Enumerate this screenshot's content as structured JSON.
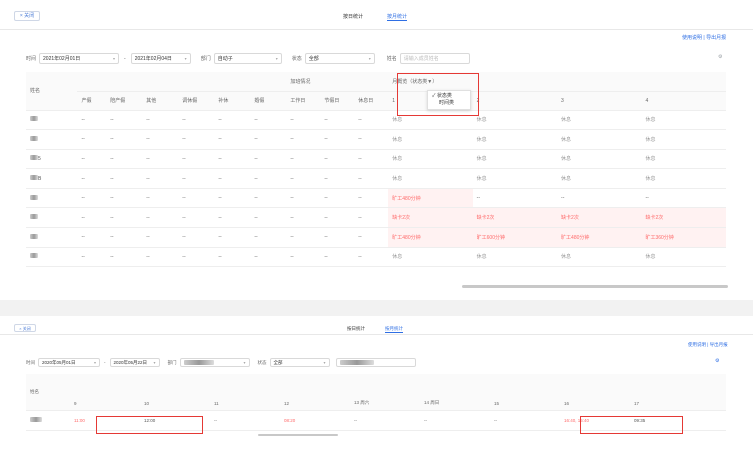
{
  "top": {
    "close_label": "× 关闭",
    "tabs": [
      "按日统计",
      "按月统计"
    ],
    "links": "使用说明 | 导出月报",
    "filters": {
      "time_label": "时间",
      "start_date": "2021年02月01日",
      "dash": "-",
      "end_date": "2021年02月04日",
      "dept_label": "部门",
      "dept_value": "自动子",
      "status_label": "状态",
      "status_value": "全部",
      "name_label": "姓名",
      "name_placeholder": "请输入成员姓名"
    },
    "table": {
      "col_name": "姓名",
      "col_overtime_group": "加班情况",
      "col_month_group": "月概览（状态类▼）",
      "leave_cols": [
        "产假",
        "陪产假",
        "其他",
        "调休假",
        "补休",
        "婚假"
      ],
      "overtime_cols": [
        "工作日",
        "节假日",
        "休息日"
      ],
      "day_cols": [
        "1",
        "2",
        "3",
        "4"
      ],
      "rows": [
        {
          "mark": "",
          "cells": [
            "--",
            "--",
            "--",
            "--",
            "--",
            "--",
            "--",
            "--",
            "--"
          ],
          "days": [
            "休息",
            "休息",
            "休息",
            "休息"
          ]
        },
        {
          "mark": "",
          "cells": [
            "--",
            "--",
            "--",
            "--",
            "--",
            "--",
            "--",
            "--",
            "--"
          ],
          "days": [
            "休息",
            "休息",
            "休息",
            "休息"
          ]
        },
        {
          "mark": "5",
          "cells": [
            "--",
            "--",
            "--",
            "--",
            "--",
            "--",
            "--",
            "--",
            "--"
          ],
          "days": [
            "休息",
            "休息",
            "休息",
            "休息"
          ]
        },
        {
          "mark": "B",
          "cells": [
            "--",
            "--",
            "--",
            "--",
            "--",
            "--",
            "--",
            "--",
            "--"
          ],
          "days": [
            "休息",
            "休息",
            "休息",
            "休息"
          ]
        },
        {
          "mark": "",
          "cells": [
            "--",
            "--",
            "--",
            "--",
            "--",
            "--",
            "--",
            "--",
            "--"
          ],
          "days": [
            "旷工480分钟",
            "--",
            "--",
            "--"
          ]
        },
        {
          "mark": "",
          "cells": [
            "--",
            "--",
            "--",
            "--",
            "--",
            "--",
            "--",
            "--",
            "--"
          ],
          "days": [
            "缺卡2次",
            "缺卡2次",
            "缺卡2次",
            "缺卡2次"
          ]
        },
        {
          "mark": "",
          "cells": [
            "--",
            "--",
            "--",
            "--",
            "--",
            "--",
            "--",
            "--",
            "--"
          ],
          "days": [
            "旷工480分钟",
            "旷工600分钟",
            "旷工480分钟",
            "旷工360分钟"
          ]
        },
        {
          "mark": "",
          "cells": [
            "--",
            "--",
            "--",
            "--",
            "--",
            "--",
            "--",
            "--",
            "--"
          ],
          "days": [
            "休息",
            "休息",
            "休息",
            "休息"
          ]
        }
      ]
    },
    "menu": {
      "check": "✓",
      "items": [
        "状态类",
        "时间类"
      ]
    }
  },
  "bottom": {
    "close_label": "× 关闭",
    "tabs": [
      "按日统计",
      "按月统计"
    ],
    "links": "使用说明 | 导出月报",
    "filters": {
      "time_label": "时间",
      "start_date": "2020年05月01日",
      "dash": "-",
      "end_date": "2020年05月22日",
      "dept_label": "部门",
      "status_label": "状态",
      "status_value": "全部"
    },
    "table": {
      "col_name": "姓名",
      "day_cols": [
        "9",
        "10",
        "11",
        "12",
        "13 周六",
        "14 周日",
        "15",
        "16",
        "17"
      ],
      "row": [
        "11:00",
        "12:00",
        "--",
        "08:20",
        "--",
        "--",
        "--",
        "16:40, 15:40",
        "09:35"
      ]
    }
  },
  "colors": {
    "accent": "#2f6fe4",
    "alert": "#ff6b6b",
    "highlight": "#e53935"
  }
}
